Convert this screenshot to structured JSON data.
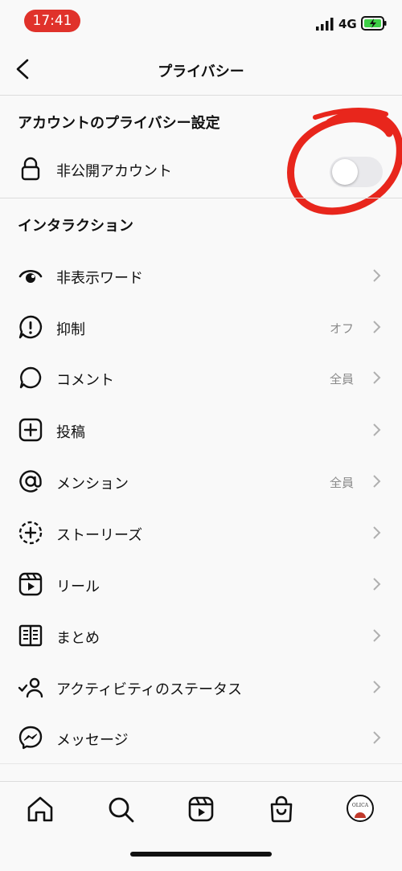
{
  "status_bar": {
    "time": "17:41",
    "network": "4G"
  },
  "header": {
    "title": "プライバシー"
  },
  "account_privacy": {
    "heading": "アカウントのプライバシー設定",
    "private_account_label": "非公開アカウント",
    "private_account_enabled": false
  },
  "interactions": {
    "heading": "インタラクション",
    "items": [
      {
        "label": "非表示ワード",
        "value": "",
        "icon": "eye-slash-icon"
      },
      {
        "label": "抑制",
        "value": "オフ",
        "icon": "alert-bubble-icon"
      },
      {
        "label": "コメント",
        "value": "全員",
        "icon": "comment-icon"
      },
      {
        "label": "投稿",
        "value": "",
        "icon": "plus-square-icon"
      },
      {
        "label": "メンション",
        "value": "全員",
        "icon": "at-sign-icon"
      },
      {
        "label": "ストーリーズ",
        "value": "",
        "icon": "story-add-icon"
      },
      {
        "label": "リール",
        "value": "",
        "icon": "reels-icon"
      },
      {
        "label": "まとめ",
        "value": "",
        "icon": "guide-book-icon"
      },
      {
        "label": "アクティビティのステータス",
        "value": "",
        "icon": "user-check-icon"
      },
      {
        "label": "メッセージ",
        "value": "",
        "icon": "messenger-icon"
      }
    ]
  },
  "tab_bar": {
    "tabs": [
      "home-icon",
      "search-icon",
      "reels-icon",
      "shop-icon",
      "profile-avatar"
    ],
    "avatar_text": "OLICA"
  },
  "colors": {
    "accent_red": "#e0322b",
    "annotation_red": "#e8261c",
    "battery_green": "#3ecf47"
  }
}
